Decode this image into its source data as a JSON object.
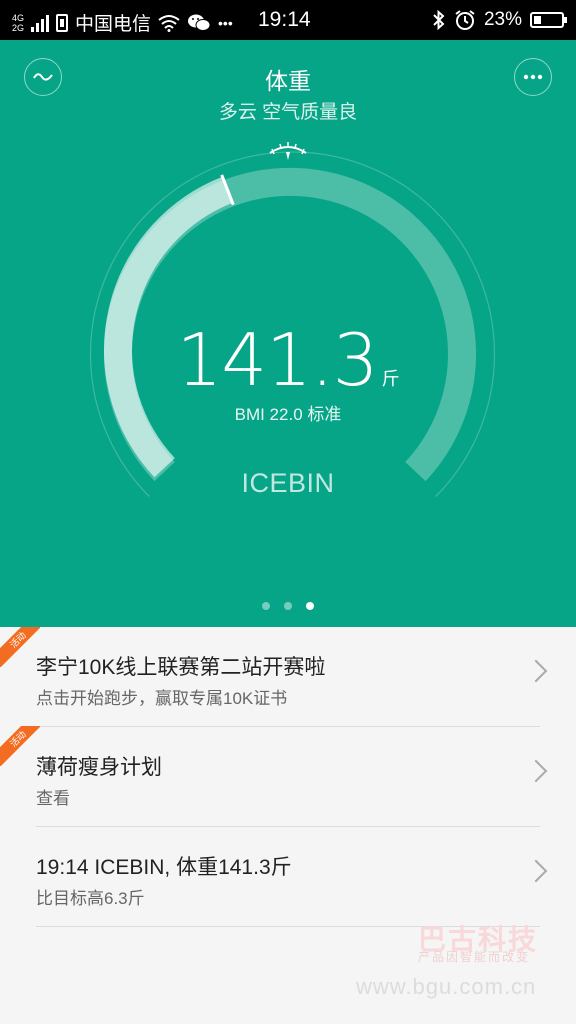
{
  "status_bar": {
    "network_top": "4G",
    "network_bottom": "2G",
    "carrier": "中国电信",
    "more": "•••",
    "time": "19:14",
    "battery": "23%"
  },
  "header": {
    "title": "体重",
    "subtitle": "多云 空气质量良",
    "left_icon": "trend-icon",
    "right_icon": "more-icon"
  },
  "gauge": {
    "weight": "141.3",
    "unit": "斤",
    "bmi": "BMI 22.0 标准",
    "user": "ICEBIN",
    "level_fraction": 0.42
  },
  "pager": {
    "count": 3,
    "active": 2
  },
  "list": {
    "items": [
      {
        "badge": "活动",
        "title": "李宁10K线上联赛第二站开赛啦",
        "subtitle": "点击开始跑步，赢取专属10K证书"
      },
      {
        "badge": "活动",
        "title": "薄荷瘦身计划",
        "subtitle": "查看"
      },
      {
        "badge": "",
        "title": "19:14 ICEBIN, 体重141.3斤",
        "subtitle": "比目标高6.3斤"
      }
    ]
  },
  "watermark": {
    "brand": "巴古科技",
    "slogan": "产品因智能而改变",
    "url": "www.bgu.com.cn"
  },
  "colors": {
    "primary": "#07a587",
    "ribbon": "#f26d21"
  }
}
